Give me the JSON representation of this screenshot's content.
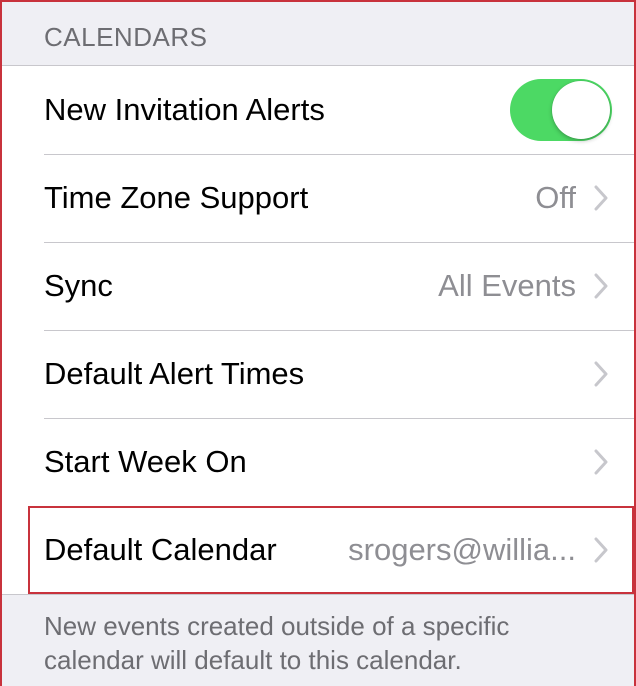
{
  "section": {
    "header": "CALENDARS"
  },
  "rows": [
    {
      "label": "New Invitation Alerts",
      "value": "",
      "toggle_on": true
    },
    {
      "label": "Time Zone Support",
      "value": "Off"
    },
    {
      "label": "Sync",
      "value": "All Events"
    },
    {
      "label": "Default Alert Times",
      "value": ""
    },
    {
      "label": "Start Week On",
      "value": ""
    },
    {
      "label": "Default Calendar",
      "value": "srogers@willia..."
    }
  ],
  "footer": {
    "note": "New events created outside of a specific calendar will default to this calendar."
  },
  "icons": {
    "chevron": "chevron-right-icon"
  },
  "colors": {
    "toggle_on": "#4cd964",
    "highlight_border": "#c8323c",
    "secondary_text": "#8e8e93",
    "background": "#efeff4"
  }
}
